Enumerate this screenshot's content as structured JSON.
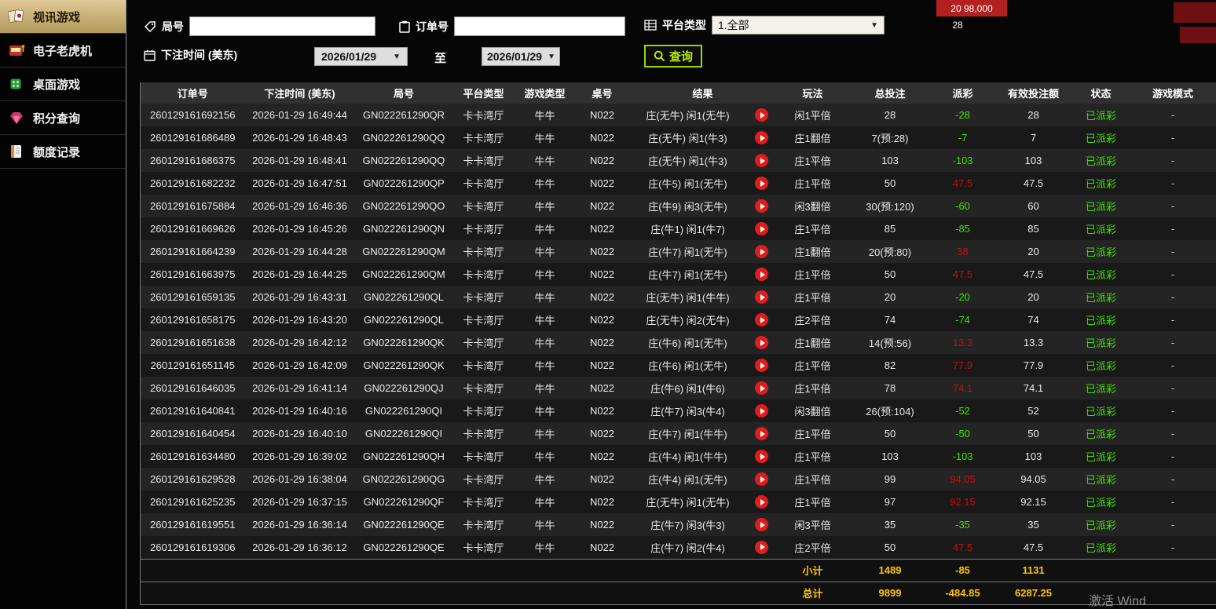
{
  "sidebar": {
    "items": [
      {
        "label": "视讯游戏",
        "active": true
      },
      {
        "label": "电子老虎机",
        "active": false
      },
      {
        "label": "桌面游戏",
        "active": false
      },
      {
        "label": "积分查询",
        "active": false
      },
      {
        "label": "额度记录",
        "active": false
      }
    ]
  },
  "filters": {
    "round_label": "局号",
    "round_value": "",
    "order_label": "订单号",
    "order_value": "",
    "platform_label": "平台类型",
    "platform_value": "1.全部",
    "bet_time_label": "下注时间 (美东)",
    "date_from": "2026/01/29",
    "to_label": "至",
    "date_to": "2026/01/29",
    "query_label": "查询"
  },
  "icons": {
    "caret_down": "▼"
  },
  "background": {
    "top_right_numbers": "20   98,000",
    "top_right_small": "28",
    "watermark": "激活 Wind"
  },
  "table": {
    "headers": [
      "订单号",
      "下注时间 (美东)",
      "局号",
      "平台类型",
      "游戏类型",
      "桌号",
      "结果",
      "玩法",
      "总投注",
      "派彩",
      "有效投注额",
      "状态",
      "游戏模式"
    ],
    "rows": [
      {
        "order": "260129161692156",
        "time": "2026-01-29 16:49:44",
        "round": "GN022261290QR",
        "platform": "卡卡湾厅",
        "game": "牛牛",
        "table": "N022",
        "result": "庄(无牛) 闲1(无牛)",
        "play_type": "闲1平倍",
        "total_bet": "28",
        "payout": "-28",
        "valid_bet": "28",
        "status": "已派彩",
        "mode": "-"
      },
      {
        "order": "260129161686489",
        "time": "2026-01-29 16:48:43",
        "round": "GN022261290QQ",
        "platform": "卡卡湾厅",
        "game": "牛牛",
        "table": "N022",
        "result": "庄(无牛) 闲1(牛3)",
        "play_type": "庄1翻倍",
        "total_bet": "7(预:28)",
        "payout": "-7",
        "valid_bet": "7",
        "status": "已派彩",
        "mode": "-"
      },
      {
        "order": "260129161686375",
        "time": "2026-01-29 16:48:41",
        "round": "GN022261290QQ",
        "platform": "卡卡湾厅",
        "game": "牛牛",
        "table": "N022",
        "result": "庄(无牛) 闲1(牛3)",
        "play_type": "庄1平倍",
        "total_bet": "103",
        "payout": "-103",
        "valid_bet": "103",
        "status": "已派彩",
        "mode": "-"
      },
      {
        "order": "260129161682232",
        "time": "2026-01-29 16:47:51",
        "round": "GN022261290QP",
        "platform": "卡卡湾厅",
        "game": "牛牛",
        "table": "N022",
        "result": "庄(牛5) 闲1(无牛)",
        "play_type": "庄1平倍",
        "total_bet": "50",
        "payout": "47.5",
        "valid_bet": "47.5",
        "status": "已派彩",
        "mode": "-"
      },
      {
        "order": "260129161675884",
        "time": "2026-01-29 16:46:36",
        "round": "GN022261290QO",
        "platform": "卡卡湾厅",
        "game": "牛牛",
        "table": "N022",
        "result": "庄(牛9) 闲3(无牛)",
        "play_type": "闲3翻倍",
        "total_bet": "30(预:120)",
        "payout": "-60",
        "valid_bet": "60",
        "status": "已派彩",
        "mode": "-"
      },
      {
        "order": "260129161669626",
        "time": "2026-01-29 16:45:26",
        "round": "GN022261290QN",
        "platform": "卡卡湾厅",
        "game": "牛牛",
        "table": "N022",
        "result": "庄(牛1) 闲1(牛7)",
        "play_type": "庄1平倍",
        "total_bet": "85",
        "payout": "-85",
        "valid_bet": "85",
        "status": "已派彩",
        "mode": "-"
      },
      {
        "order": "260129161664239",
        "time": "2026-01-29 16:44:28",
        "round": "GN022261290QM",
        "platform": "卡卡湾厅",
        "game": "牛牛",
        "table": "N022",
        "result": "庄(牛7) 闲1(无牛)",
        "play_type": "庄1翻倍",
        "total_bet": "20(预:80)",
        "payout": "38",
        "valid_bet": "20",
        "status": "已派彩",
        "mode": "-"
      },
      {
        "order": "260129161663975",
        "time": "2026-01-29 16:44:25",
        "round": "GN022261290QM",
        "platform": "卡卡湾厅",
        "game": "牛牛",
        "table": "N022",
        "result": "庄(牛7) 闲1(无牛)",
        "play_type": "庄1平倍",
        "total_bet": "50",
        "payout": "47.5",
        "valid_bet": "47.5",
        "status": "已派彩",
        "mode": "-"
      },
      {
        "order": "260129161659135",
        "time": "2026-01-29 16:43:31",
        "round": "GN022261290QL",
        "platform": "卡卡湾厅",
        "game": "牛牛",
        "table": "N022",
        "result": "庄(无牛) 闲1(牛牛)",
        "play_type": "庄1平倍",
        "total_bet": "20",
        "payout": "-20",
        "valid_bet": "20",
        "status": "已派彩",
        "mode": "-"
      },
      {
        "order": "260129161658175",
        "time": "2026-01-29 16:43:20",
        "round": "GN022261290QL",
        "platform": "卡卡湾厅",
        "game": "牛牛",
        "table": "N022",
        "result": "庄(无牛) 闲2(无牛)",
        "play_type": "庄2平倍",
        "total_bet": "74",
        "payout": "-74",
        "valid_bet": "74",
        "status": "已派彩",
        "mode": "-"
      },
      {
        "order": "260129161651638",
        "time": "2026-01-29 16:42:12",
        "round": "GN022261290QK",
        "platform": "卡卡湾厅",
        "game": "牛牛",
        "table": "N022",
        "result": "庄(牛6) 闲1(无牛)",
        "play_type": "庄1翻倍",
        "total_bet": "14(预:56)",
        "payout": "13.3",
        "valid_bet": "13.3",
        "status": "已派彩",
        "mode": "-"
      },
      {
        "order": "260129161651145",
        "time": "2026-01-29 16:42:09",
        "round": "GN022261290QK",
        "platform": "卡卡湾厅",
        "game": "牛牛",
        "table": "N022",
        "result": "庄(牛6) 闲1(无牛)",
        "play_type": "庄1平倍",
        "total_bet": "82",
        "payout": "77.9",
        "valid_bet": "77.9",
        "status": "已派彩",
        "mode": "-"
      },
      {
        "order": "260129161646035",
        "time": "2026-01-29 16:41:14",
        "round": "GN022261290QJ",
        "platform": "卡卡湾厅",
        "game": "牛牛",
        "table": "N022",
        "result": "庄(牛6) 闲1(牛6)",
        "play_type": "庄1平倍",
        "total_bet": "78",
        "payout": "74.1",
        "valid_bet": "74.1",
        "status": "已派彩",
        "mode": "-"
      },
      {
        "order": "260129161640841",
        "time": "2026-01-29 16:40:16",
        "round": "GN022261290QI",
        "platform": "卡卡湾厅",
        "game": "牛牛",
        "table": "N022",
        "result": "庄(牛7) 闲3(牛4)",
        "play_type": "闲3翻倍",
        "total_bet": "26(预:104)",
        "payout": "-52",
        "valid_bet": "52",
        "status": "已派彩",
        "mode": "-"
      },
      {
        "order": "260129161640454",
        "time": "2026-01-29 16:40:10",
        "round": "GN022261290QI",
        "platform": "卡卡湾厅",
        "game": "牛牛",
        "table": "N022",
        "result": "庄(牛7) 闲1(牛牛)",
        "play_type": "庄1平倍",
        "total_bet": "50",
        "payout": "-50",
        "valid_bet": "50",
        "status": "已派彩",
        "mode": "-"
      },
      {
        "order": "260129161634480",
        "time": "2026-01-29 16:39:02",
        "round": "GN022261290QH",
        "platform": "卡卡湾厅",
        "game": "牛牛",
        "table": "N022",
        "result": "庄(牛4) 闲1(牛牛)",
        "play_type": "庄1平倍",
        "total_bet": "103",
        "payout": "-103",
        "valid_bet": "103",
        "status": "已派彩",
        "mode": "-"
      },
      {
        "order": "260129161629528",
        "time": "2026-01-29 16:38:04",
        "round": "GN022261290QG",
        "platform": "卡卡湾厅",
        "game": "牛牛",
        "table": "N022",
        "result": "庄(牛4) 闲1(无牛)",
        "play_type": "庄1平倍",
        "total_bet": "99",
        "payout": "94.05",
        "valid_bet": "94.05",
        "status": "已派彩",
        "mode": "-"
      },
      {
        "order": "260129161625235",
        "time": "2026-01-29 16:37:15",
        "round": "GN022261290QF",
        "platform": "卡卡湾厅",
        "game": "牛牛",
        "table": "N022",
        "result": "庄(无牛) 闲1(无牛)",
        "play_type": "庄1平倍",
        "total_bet": "97",
        "payout": "92.15",
        "valid_bet": "92.15",
        "status": "已派彩",
        "mode": "-"
      },
      {
        "order": "260129161619551",
        "time": "2026-01-29 16:36:14",
        "round": "GN022261290QE",
        "platform": "卡卡湾厅",
        "game": "牛牛",
        "table": "N022",
        "result": "庄(牛7) 闲3(牛3)",
        "play_type": "闲3平倍",
        "total_bet": "35",
        "payout": "-35",
        "valid_bet": "35",
        "status": "已派彩",
        "mode": "-"
      },
      {
        "order": "260129161619306",
        "time": "2026-01-29 16:36:12",
        "round": "GN022261290QE",
        "platform": "卡卡湾厅",
        "game": "牛牛",
        "table": "N022",
        "result": "庄(牛7) 闲2(牛4)",
        "play_type": "庄2平倍",
        "total_bet": "50",
        "payout": "47.5",
        "valid_bet": "47.5",
        "status": "已派彩",
        "mode": "-"
      }
    ],
    "subtotal": {
      "label": "小计",
      "total_bet": "1489",
      "payout": "-85",
      "valid_bet": "1131"
    },
    "total": {
      "label": "总计",
      "total_bet": "9899",
      "payout": "-484.85",
      "valid_bet": "6287.25"
    }
  }
}
